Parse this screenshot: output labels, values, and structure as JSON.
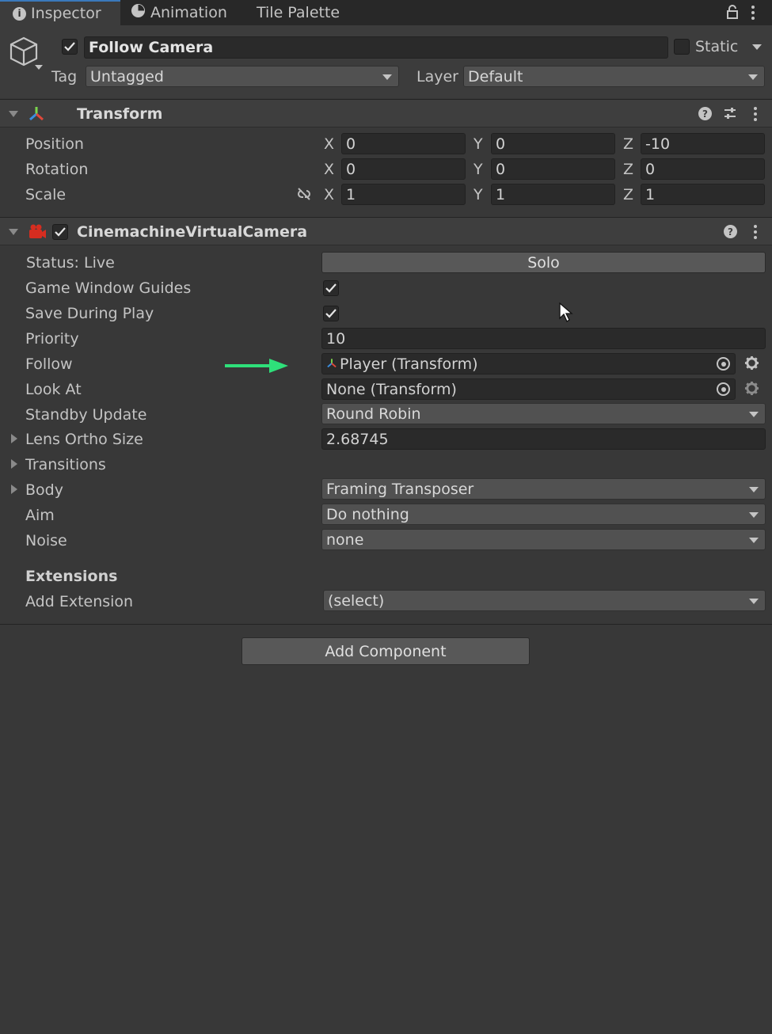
{
  "tabs": [
    {
      "label": "Inspector",
      "icon": "info-icon",
      "active": true
    },
    {
      "label": "Animation",
      "icon": "clock-icon",
      "active": false
    },
    {
      "label": "Tile Palette",
      "icon": "",
      "active": false
    }
  ],
  "gameobject": {
    "name": "Follow Camera",
    "active": true,
    "static_label": "Static",
    "tag_label": "Tag",
    "tag_value": "Untagged",
    "layer_label": "Layer",
    "layer_value": "Default"
  },
  "transform": {
    "title": "Transform",
    "position": {
      "label": "Position",
      "x": "0",
      "y": "0",
      "z": "-10"
    },
    "rotation": {
      "label": "Rotation",
      "x": "0",
      "y": "0",
      "z": "0"
    },
    "scale": {
      "label": "Scale",
      "x": "1",
      "y": "1",
      "z": "1"
    },
    "axis": {
      "x": "X",
      "y": "Y",
      "z": "Z"
    }
  },
  "vcam": {
    "title": "CinemachineVirtualCamera",
    "status_label": "Status: Live",
    "solo_label": "Solo",
    "game_window_guides_label": "Game Window Guides",
    "save_during_play_label": "Save During Play",
    "priority_label": "Priority",
    "priority_value": "10",
    "follow_label": "Follow",
    "follow_value": "Player (Transform)",
    "look_at_label": "Look At",
    "look_at_value": "None (Transform)",
    "standby_label": "Standby Update",
    "standby_value": "Round Robin",
    "lens_label": "Lens Ortho Size",
    "lens_value": "2.68745",
    "transitions_label": "Transitions",
    "body_label": "Body",
    "body_value": "Framing Transposer",
    "aim_label": "Aim",
    "aim_value": "Do nothing",
    "noise_label": "Noise",
    "noise_value": "none",
    "extensions_label": "Extensions",
    "add_extension_label": "Add Extension",
    "add_extension_value": "(select)"
  },
  "add_component_label": "Add Component",
  "colors": {
    "accent": "#3a79bb",
    "arrow": "#2ee07a"
  }
}
